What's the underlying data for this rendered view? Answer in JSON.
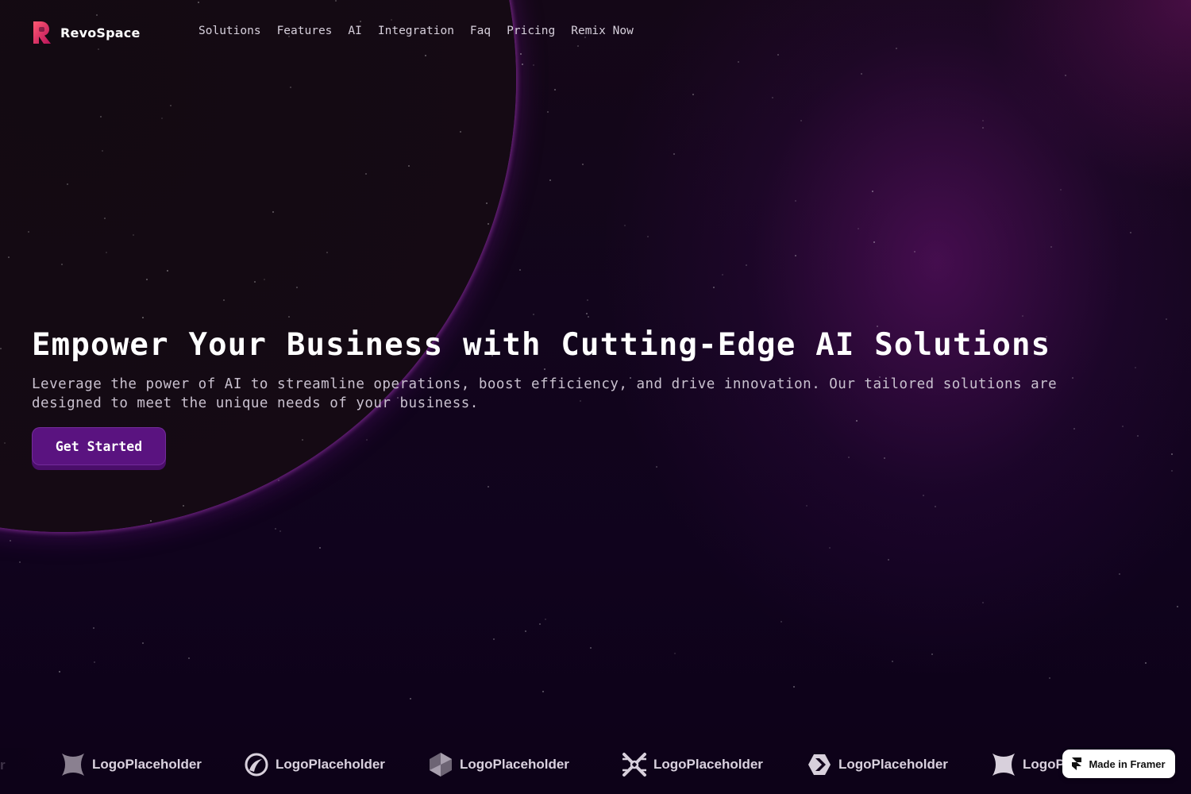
{
  "brand": {
    "name": "RevoSpace",
    "logo_icon": "revospace-logo-icon",
    "accent_gradient": [
      "#ff4f6a",
      "#c2185b"
    ]
  },
  "nav": {
    "links": [
      "Solutions",
      "Features",
      "AI",
      "Integration",
      "Faq",
      "Pricing",
      "Remix Now"
    ]
  },
  "hero": {
    "title": "Empower Your Business with Cutting-Edge AI Solutions",
    "subtitle": "Leverage the power of AI to streamline operations, boost efficiency, and drive innovation. Our tailored solutions are designed to meet the unique needs of your business.",
    "cta_label": "Get Started"
  },
  "logos": {
    "partial_left_text": "r",
    "items": [
      {
        "label": "LogoPlaceholder",
        "icon": "star-shape-icon"
      },
      {
        "label": "LogoPlaceholder",
        "icon": "circle-swirl-icon"
      },
      {
        "label": "LogoPlaceholder",
        "icon": "hexagon-cube-icon"
      },
      {
        "label": "LogoPlaceholder",
        "icon": "x-burst-icon"
      },
      {
        "label": "LogoPlaceholder",
        "icon": "hexagon-arrow-icon"
      },
      {
        "label": "LogoPlaceholder",
        "icon": "star-shape-icon"
      }
    ]
  },
  "framer_badge": {
    "label": "Made in Framer",
    "icon": "framer-icon"
  },
  "colors": {
    "background": "#10031d",
    "glow": "#6e1478",
    "cta": "#5a1380",
    "text_muted": "#c9c1cf"
  }
}
